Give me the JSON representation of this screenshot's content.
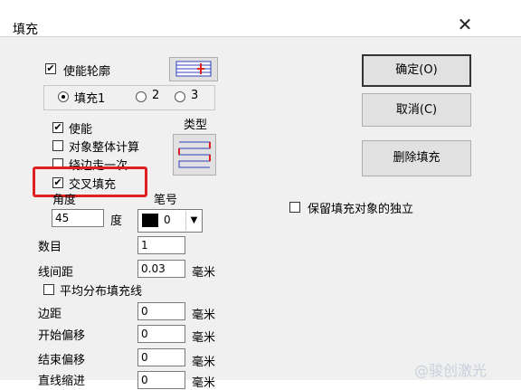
{
  "window": {
    "title": "填充",
    "close_glyph": "✕"
  },
  "outline": {
    "checked": true,
    "label": "使能轮廓"
  },
  "fill_tabs": {
    "selected": "填充1",
    "options": [
      "填充1",
      "2",
      "3"
    ]
  },
  "fill": {
    "enable_label": "使能",
    "enable_checked": true,
    "whole_calc_label": "对象整体计算",
    "whole_calc_checked": false,
    "edge_once_label": "绕边走一次",
    "edge_once_checked": false,
    "cross_fill_label": "交叉填充",
    "cross_fill_checked": true,
    "type_label": "类型"
  },
  "angle": {
    "label": "角度",
    "value": "45",
    "unit": "度"
  },
  "pen": {
    "label": "笔号",
    "value": "0",
    "swatch_color": "#000000"
  },
  "count": {
    "label": "数目",
    "value": "1"
  },
  "line_spacing": {
    "label": "线间距",
    "value": "0.03",
    "unit": "毫米"
  },
  "even_distribute": {
    "label": "平均分布填充线",
    "checked": false
  },
  "margin": {
    "label": "边距",
    "value": "0",
    "unit": "毫米"
  },
  "start_offset": {
    "label": "开始偏移",
    "value": "0",
    "unit": "毫米"
  },
  "end_offset": {
    "label": "结束偏移",
    "value": "0",
    "unit": "毫米"
  },
  "line_shrink": {
    "label": "直线缩进",
    "value": "0",
    "unit": "毫米"
  },
  "buttons": {
    "ok": "确定(O)",
    "cancel": "取消(C)",
    "delete_fill": "删除填充"
  },
  "keep_independent": {
    "label": "保留填充对象的独立",
    "checked": false
  },
  "watermark": "@骏创激光",
  "colors": {
    "highlight": "#e02020",
    "icon_blue": "#2f3fbf",
    "icon_red": "#e02020"
  }
}
